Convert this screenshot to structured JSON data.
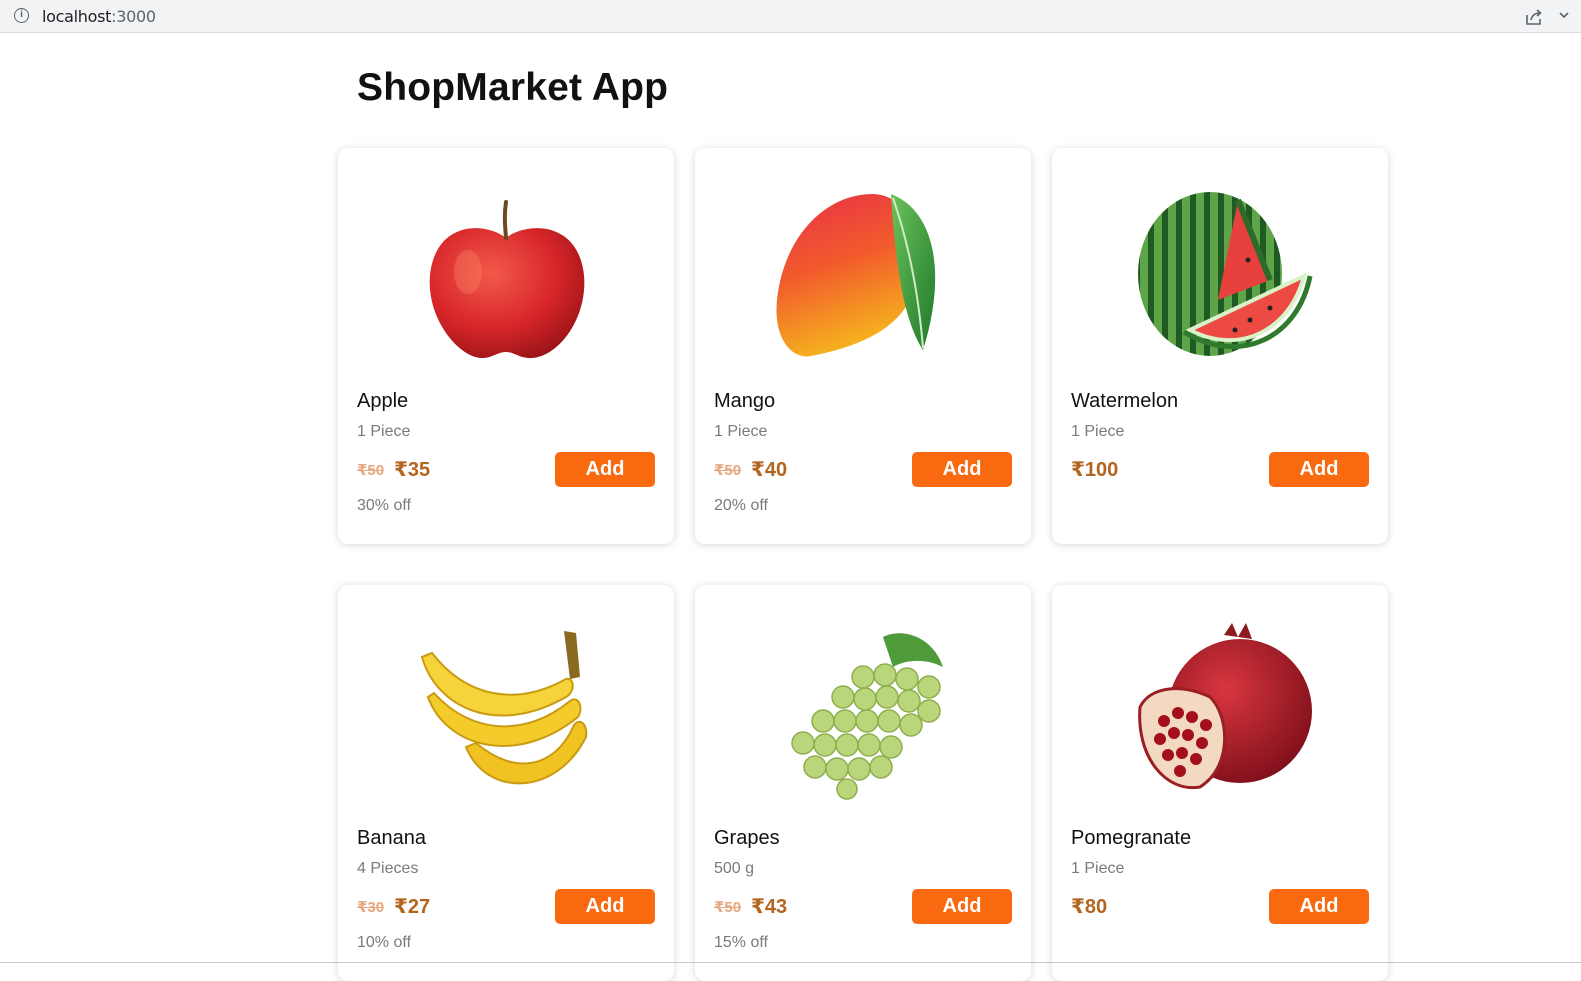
{
  "browser": {
    "url_host": "localhost",
    "url_port": ":3000"
  },
  "app": {
    "title": "ShopMarket App"
  },
  "colors": {
    "button": "#f96a10",
    "price": "#b3641e",
    "old_price": "#e6a77d"
  },
  "products": [
    {
      "name": "Apple",
      "quantity": "1 Piece",
      "old_price": "₹50",
      "price": "₹35",
      "discount": "30% off",
      "button": "Add",
      "image": "apple-image"
    },
    {
      "name": "Mango",
      "quantity": "1 Piece",
      "old_price": "₹50",
      "price": "₹40",
      "discount": "20% off",
      "button": "Add",
      "image": "mango-image"
    },
    {
      "name": "Watermelon",
      "quantity": "1 Piece",
      "old_price": "",
      "price": "₹100",
      "discount": "",
      "button": "Add",
      "image": "watermelon-image"
    },
    {
      "name": "Banana",
      "quantity": "4 Pieces",
      "old_price": "₹30",
      "price": "₹27",
      "discount": "10% off",
      "button": "Add",
      "image": "banana-image"
    },
    {
      "name": "Grapes",
      "quantity": "500 g",
      "old_price": "₹50",
      "price": "₹43",
      "discount": "15% off",
      "button": "Add",
      "image": "grapes-image"
    },
    {
      "name": "Pomegranate",
      "quantity": "1 Piece",
      "old_price": "",
      "price": "₹80",
      "discount": "",
      "button": "Add",
      "image": "pomegranate-image"
    }
  ]
}
